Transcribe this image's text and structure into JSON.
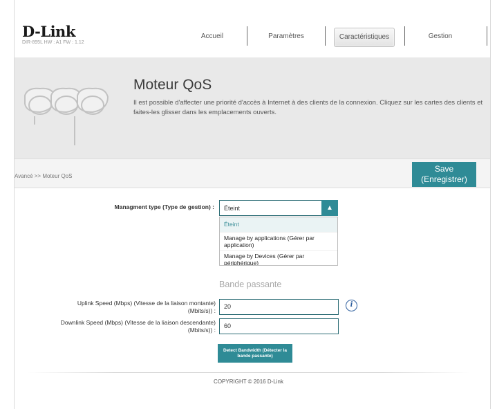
{
  "header": {
    "logo": "D-Link",
    "hw_info": "DIR-895L   HW : A1   FW : 1.12",
    "nav": [
      {
        "label": "Accueil"
      },
      {
        "label": "Paramètres"
      },
      {
        "label": "Caractéristiques",
        "active": true
      },
      {
        "label": "Gestion"
      }
    ]
  },
  "banner": {
    "title": "Moteur QoS",
    "description": "Il est possible d'affecter une priorité d'accès à Internet à des clients de la connexion. Cliquez sur les cartes des clients et faites-les glisser dans les emplacements ouverts."
  },
  "breadcrumb": "Avancé >> Moteur QoS",
  "save_button": "Save\n(Enregistrer)",
  "form": {
    "management_label": "Managment type (Type de gestion) :",
    "management_value": "Éteint",
    "dropdown_options": [
      "Éteint",
      "Manage by applications (Gérer par application)",
      "Manage by Devices (Gérer par périphérique)"
    ],
    "bandwidth_title": "Bande passante",
    "uplink_label_1": "Uplink Speed (Mbps) (Vitesse de la liaison montante)",
    "uplink_label_2": "(Mbits/s)) :",
    "uplink_value": "20",
    "downlink_label_1": "Downlink Speed (Mbps) (Vitesse de la liaison descendante)",
    "downlink_label_2": "(Mbits/s)) :",
    "downlink_value": "60",
    "detect_button": "Detect Bandwidth (Détecter la bande passante)"
  },
  "footer": {
    "copyright": "COPYRIGHT © 2016 D-Link"
  },
  "colors": {
    "accent": "#2f8b96",
    "banner_bg": "#e9e9e9"
  }
}
